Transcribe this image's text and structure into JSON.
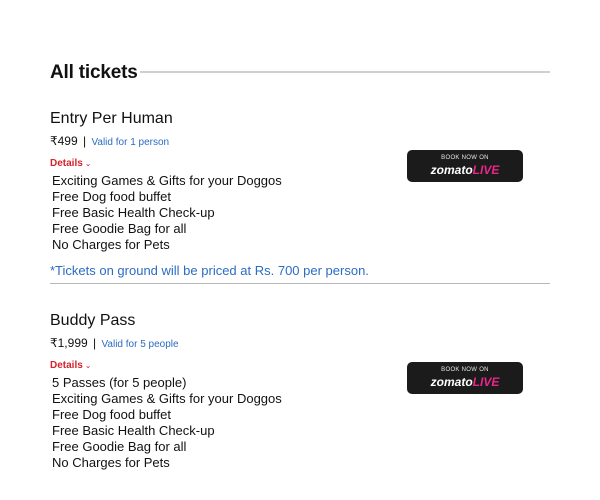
{
  "section": {
    "title": "All tickets"
  },
  "tickets": [
    {
      "name": "Entry Per Human",
      "price": "₹499",
      "separator": "|",
      "validity": "Valid for 1 person",
      "details_label": "Details",
      "details_icon": "chevron-down-icon",
      "features": [
        "Exciting Games & Gifts for your Doggos",
        "Free Dog food buffet",
        "Free Basic Health Check-up",
        "Free Goodie Bag for all",
        "No Charges for Pets"
      ],
      "note": "*Tickets on ground will be priced at Rs. 700 per person.",
      "book": {
        "top_text": "BOOK NOW ON",
        "brand_main": "zomato",
        "brand_accent": "LIVE"
      }
    },
    {
      "name": "Buddy Pass",
      "price": "₹1,999",
      "separator": "|",
      "validity": "Valid for 5 people",
      "details_label": "Details",
      "details_icon": "chevron-down-icon",
      "features": [
        "5 Passes (for 5 people)",
        "Exciting Games & Gifts for your Doggos",
        "Free Dog food buffet",
        "Free Basic Health Check-up",
        "Free Goodie Bag for all",
        "No Charges for Pets"
      ],
      "book": {
        "top_text": "BOOK NOW ON",
        "brand_main": "zomato",
        "brand_accent": "LIVE"
      }
    }
  ],
  "colors": {
    "link_blue": "#2b6cc4",
    "details_red": "#d4232b",
    "button_bg": "#1b1b1b",
    "brand_accent": "#e9258a",
    "rule": "#cfcfcf"
  }
}
